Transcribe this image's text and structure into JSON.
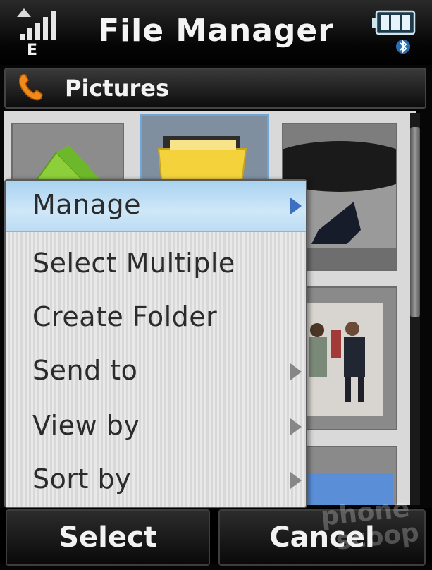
{
  "header": {
    "title": "File Manager",
    "signal_icon": "signal-bars-icon",
    "network_label": "E",
    "battery_icon": "battery-icon",
    "bluetooth_icon": "bluetooth-icon"
  },
  "folder": {
    "icon": "phone-handset-icon",
    "label": "Pictures"
  },
  "grid": {
    "items": [
      {
        "kind": "folder",
        "icon": "green-folder-icon"
      },
      {
        "kind": "folder",
        "icon": "yellow-folder-icon",
        "selected": true
      },
      {
        "kind": "photo",
        "subject": "street-photo"
      },
      {
        "kind": "photo",
        "subject": "crowd-photo"
      },
      {
        "kind": "photo",
        "subject": "sky-photo"
      }
    ]
  },
  "menu": {
    "items": [
      {
        "label": "Manage",
        "submenu": true,
        "highlighted": true
      },
      {
        "label": "Select Multiple",
        "submenu": false
      },
      {
        "label": "Create Folder",
        "submenu": false
      },
      {
        "label": "Send to",
        "submenu": true
      },
      {
        "label": "View by",
        "submenu": true
      },
      {
        "label": "Sort by",
        "submenu": true
      }
    ]
  },
  "softkeys": {
    "left": "Select",
    "right": "Cancel"
  },
  "watermark": {
    "line1": "phone",
    "line2": "scoop"
  },
  "colors": {
    "highlight": "#bcdcf3",
    "menu_text": "#2b2b2b",
    "selection_border": "#6fa7d8"
  }
}
